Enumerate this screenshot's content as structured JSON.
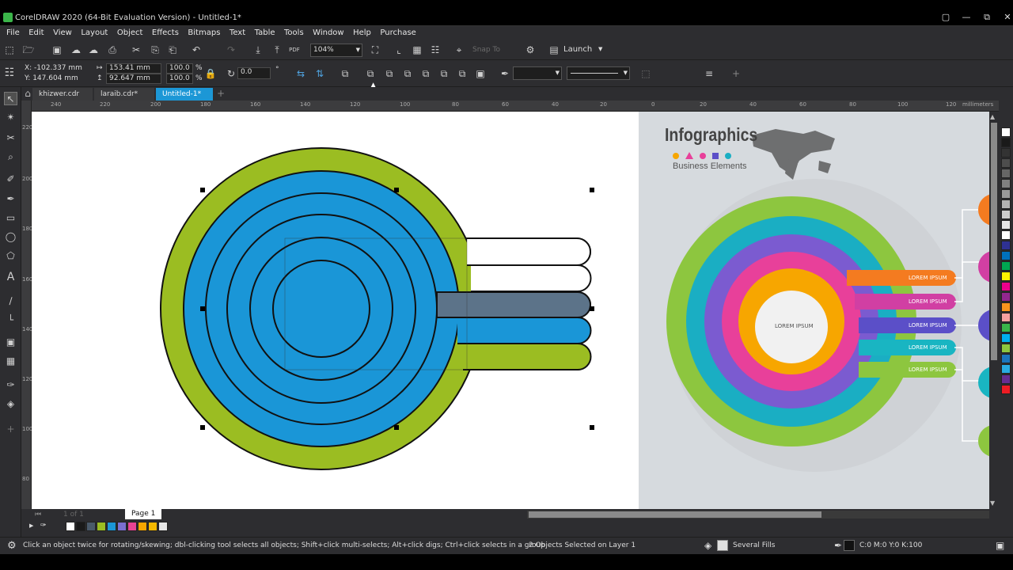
{
  "window": {
    "title": "CorelDRAW 2020 (64-Bit Evaluation Version) - Untitled-1*",
    "buttons": [
      "▢",
      "—",
      "⧉",
      "✕"
    ]
  },
  "menu": [
    "File",
    "Edit",
    "View",
    "Layout",
    "Object",
    "Effects",
    "Bitmaps",
    "Text",
    "Table",
    "Tools",
    "Window",
    "Help",
    "Purchase"
  ],
  "toolbar": {
    "zoom": "104%",
    "snap_to": "Snap To",
    "launch": "Launch"
  },
  "property_bar": {
    "x": "X: -102.337 mm",
    "y": "Y: 147.604 mm",
    "width": "153.41 mm",
    "height": "92.647 mm",
    "scale_w": "100.0",
    "scale_h": "100.0",
    "pct": "%",
    "rotation": "0.0",
    "degree": "°"
  },
  "tabs": [
    {
      "label": "khizwer.cdr"
    },
    {
      "label": "laraib.cdr*"
    },
    {
      "label": "Untitled-1*"
    }
  ],
  "ruler": {
    "h_ticks": [
      "240",
      "220",
      "200",
      "180",
      "160",
      "140",
      "120",
      "100",
      "80",
      "60",
      "40",
      "20",
      "0",
      "20",
      "40",
      "60",
      "80",
      "100",
      "120"
    ],
    "unit": "millimeters",
    "v_ticks": [
      "220",
      "200",
      "180",
      "160",
      "140",
      "120",
      "100",
      "80"
    ]
  },
  "pagebar": {
    "page_count": "1 of 1",
    "page_tab": "Page 1"
  },
  "infographic": {
    "title": "Infographics",
    "subtitle": "Business Elements",
    "center_label": "LOREM IPSUM",
    "labels": [
      "LOREM IPSUM",
      "LOREM IPSUM",
      "LOREM IPSUM",
      "LOREM IPSUM",
      "LOREM IPSUM"
    ]
  },
  "status": {
    "hint": "Click an object twice for rotating/skewing; dbl-clicking tool selects all objects; Shift+click multi-selects; Alt+click digs; Ctrl+click selects in a group",
    "selection": "2 Objects Selected on Layer 1",
    "fill": "Several Fills",
    "outline": "C:0 M:0 Y:0 K:100"
  },
  "colors": {
    "green": "#9bbd22",
    "blue": "#1a96d7",
    "slate": "#5c7389",
    "accent": "#1c97d6"
  },
  "palette": [
    "#ffffff",
    "#1a1a1a",
    "#333333",
    "#4d4d4d",
    "#666666",
    "#808080",
    "#999999",
    "#b3b3b3",
    "#cccccc",
    "#e6e6e6",
    "#ffffff",
    "#2e3192",
    "#0071bc",
    "#00a651",
    "#fff200",
    "#ec008c",
    "#92278f",
    "#f7941d",
    "#f5a0a0",
    "#39b54a",
    "#00aeef",
    "#8dc63f",
    "#1b75bc",
    "#29abe2",
    "#662d91",
    "#ed1c24"
  ],
  "document_palette": [
    "#ffffff",
    "#1a1a1a",
    "#4a5a6a",
    "#9bbd22",
    "#1a96d7",
    "#7b6fd0",
    "#e84393",
    "#f7a600",
    "#f5b800",
    "#e6e6e6"
  ]
}
